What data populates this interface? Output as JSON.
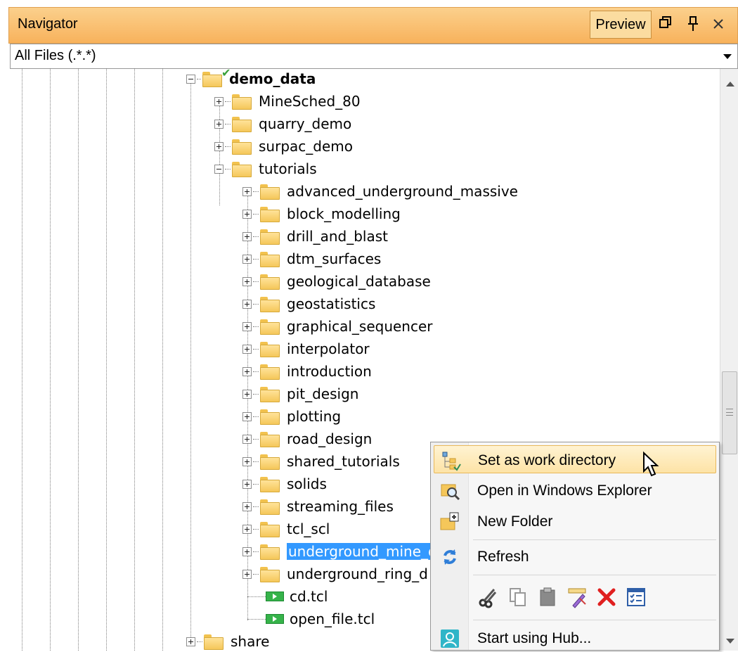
{
  "panel": {
    "title": "Navigator",
    "preview_label": "Preview",
    "accent_color": "#f8b25c"
  },
  "filter": {
    "value": "All Files (.*.*)"
  },
  "tree": {
    "root": {
      "label": "demo_data",
      "icon": "folder-open-check-icon"
    },
    "level1": [
      {
        "label": "MineSched_80"
      },
      {
        "label": "quarry_demo"
      },
      {
        "label": "surpac_demo"
      },
      {
        "label": "tutorials"
      }
    ],
    "tutorials": [
      {
        "label": "advanced_underground_massive"
      },
      {
        "label": "block_modelling"
      },
      {
        "label": "drill_and_blast"
      },
      {
        "label": "dtm_surfaces"
      },
      {
        "label": "geological_database"
      },
      {
        "label": "geostatistics"
      },
      {
        "label": "graphical_sequencer"
      },
      {
        "label": "interpolator"
      },
      {
        "label": "introduction"
      },
      {
        "label": "pit_design"
      },
      {
        "label": "plotting"
      },
      {
        "label": "road_design"
      },
      {
        "label": "shared_tutorials"
      },
      {
        "label": "solids"
      },
      {
        "label": "streaming_files"
      },
      {
        "label": "tcl_scl"
      },
      {
        "label": "underground_mine_d"
      },
      {
        "label": "underground_ring_d"
      }
    ],
    "files": [
      {
        "label": "cd.tcl",
        "icon": "tcl-script-icon"
      },
      {
        "label": "open_file.tcl",
        "icon": "tcl-script-icon"
      }
    ],
    "sibling": {
      "label": "share"
    },
    "selection_color": "#3399ff"
  },
  "context_menu": {
    "items": [
      {
        "label": "Set as work directory",
        "icon": "set-work-directory-icon"
      },
      {
        "label": "Open in Windows Explorer",
        "icon": "open-explorer-icon"
      },
      {
        "label": "New Folder",
        "icon": "new-folder-icon"
      },
      {
        "label": "Refresh",
        "icon": "refresh-icon"
      },
      {
        "label": "Start using Hub...",
        "icon": "hub-icon"
      }
    ],
    "tool_icons": [
      "cut-icon",
      "copy-icon",
      "paste-icon",
      "rename-icon",
      "delete-icon",
      "properties-icon"
    ]
  }
}
